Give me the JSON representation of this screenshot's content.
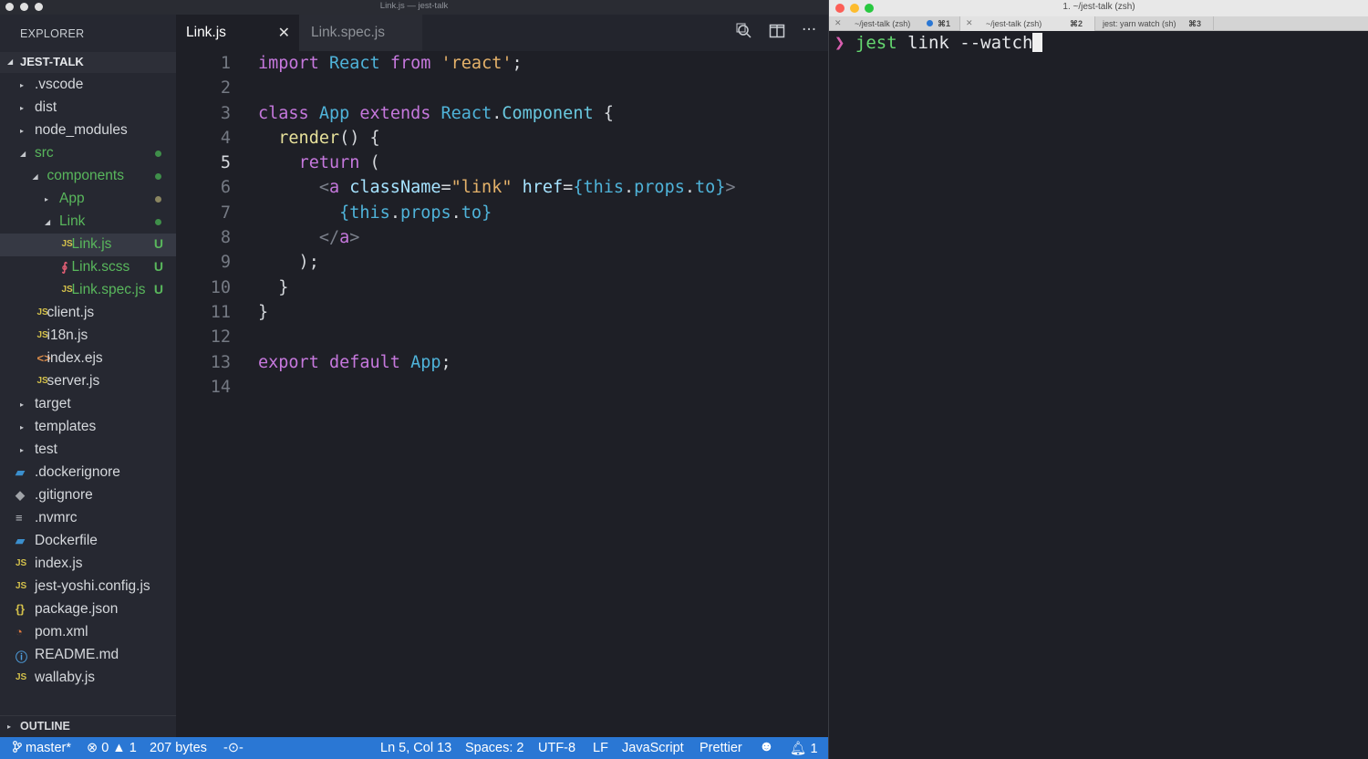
{
  "vscode": {
    "title": "Link.js — jest-talk",
    "explorer_label": "EXPLORER",
    "project": "JEST-TALK",
    "tree": [
      {
        "name": ".vscode",
        "indent": 0,
        "kind": "folder",
        "open": false
      },
      {
        "name": "dist",
        "indent": 0,
        "kind": "folder",
        "open": false
      },
      {
        "name": "node_modules",
        "indent": 0,
        "kind": "folder",
        "open": false
      },
      {
        "name": "src",
        "indent": 0,
        "kind": "folder",
        "open": true,
        "status": "green-dot"
      },
      {
        "name": "components",
        "indent": 1,
        "kind": "folder",
        "open": true,
        "status": "green-dot"
      },
      {
        "name": "App",
        "indent": 2,
        "kind": "folder",
        "open": false,
        "status": "olive-dot"
      },
      {
        "name": "Link",
        "indent": 2,
        "kind": "folder",
        "open": true,
        "status": "green-dot"
      },
      {
        "name": "Link.js",
        "indent": 3,
        "kind": "js",
        "badge": "U",
        "selected": true
      },
      {
        "name": "Link.scss",
        "indent": 3,
        "kind": "scss",
        "badge": "U"
      },
      {
        "name": "Link.spec.js",
        "indent": 3,
        "kind": "js",
        "badge": "U"
      },
      {
        "name": "client.js",
        "indent": 1,
        "kind": "js"
      },
      {
        "name": "i18n.js",
        "indent": 1,
        "kind": "js"
      },
      {
        "name": "index.ejs",
        "indent": 1,
        "kind": "html"
      },
      {
        "name": "server.js",
        "indent": 1,
        "kind": "js"
      },
      {
        "name": "target",
        "indent": 0,
        "kind": "folder",
        "open": false
      },
      {
        "name": "templates",
        "indent": 0,
        "kind": "folder",
        "open": false
      },
      {
        "name": "test",
        "indent": 0,
        "kind": "folder",
        "open": false
      },
      {
        "name": ".dockerignore",
        "indent": 0,
        "kind": "docker"
      },
      {
        "name": ".gitignore",
        "indent": 0,
        "kind": "git"
      },
      {
        "name": ".nvmrc",
        "indent": 0,
        "kind": "txt"
      },
      {
        "name": "Dockerfile",
        "indent": 0,
        "kind": "docker"
      },
      {
        "name": "index.js",
        "indent": 0,
        "kind": "js"
      },
      {
        "name": "jest-yoshi.config.js",
        "indent": 0,
        "kind": "js"
      },
      {
        "name": "package.json",
        "indent": 0,
        "kind": "json"
      },
      {
        "name": "pom.xml",
        "indent": 0,
        "kind": "rss"
      },
      {
        "name": "README.md",
        "indent": 0,
        "kind": "info"
      },
      {
        "name": "wallaby.js",
        "indent": 0,
        "kind": "js"
      }
    ],
    "outline_label": "OUTLINE",
    "tabs": [
      {
        "label": "Link.js",
        "active": true
      },
      {
        "label": "Link.spec.js",
        "active": false
      }
    ],
    "icons": {
      "js": "JS",
      "folder_closed": "▸",
      "folder_open": "◢",
      "close": "✕",
      "search_editor": "⚲",
      "split": "◫",
      "more": "···"
    },
    "code_lines": [
      "import React from 'react';",
      "",
      "class App extends React.Component {",
      "  render() {",
      "    return (",
      "      <a className=\"link\" href={this.props.to}>",
      "        {this.props.to}",
      "      </a>",
      "    );",
      "  }",
      "}",
      "",
      "export default App;",
      ""
    ],
    "current_line": 5,
    "status": {
      "branch": "master*",
      "errors": "0",
      "warnings": "1",
      "size": "207 bytes",
      "position": "Ln 5, Col 13",
      "spaces": "Spaces: 2",
      "encoding": "UTF-8",
      "eol": "LF",
      "language": "JavaScript",
      "formatter": "Prettier",
      "notifications": "1"
    },
    "colors": {
      "statusbar": "#2a77d4",
      "git_green": "#59b75c"
    }
  },
  "terminal": {
    "title": "1. ~/jest-talk (zsh)",
    "tabs": [
      {
        "label": "~/jest-talk (zsh)",
        "shortcut": "⌘1"
      },
      {
        "label": "~/jest-talk (zsh)",
        "shortcut": "⌘2"
      },
      {
        "label": "jest: yarn watch (sh)",
        "shortcut": "⌘3"
      }
    ],
    "prompt": "❯",
    "command": "jest",
    "args": " link --watch"
  }
}
